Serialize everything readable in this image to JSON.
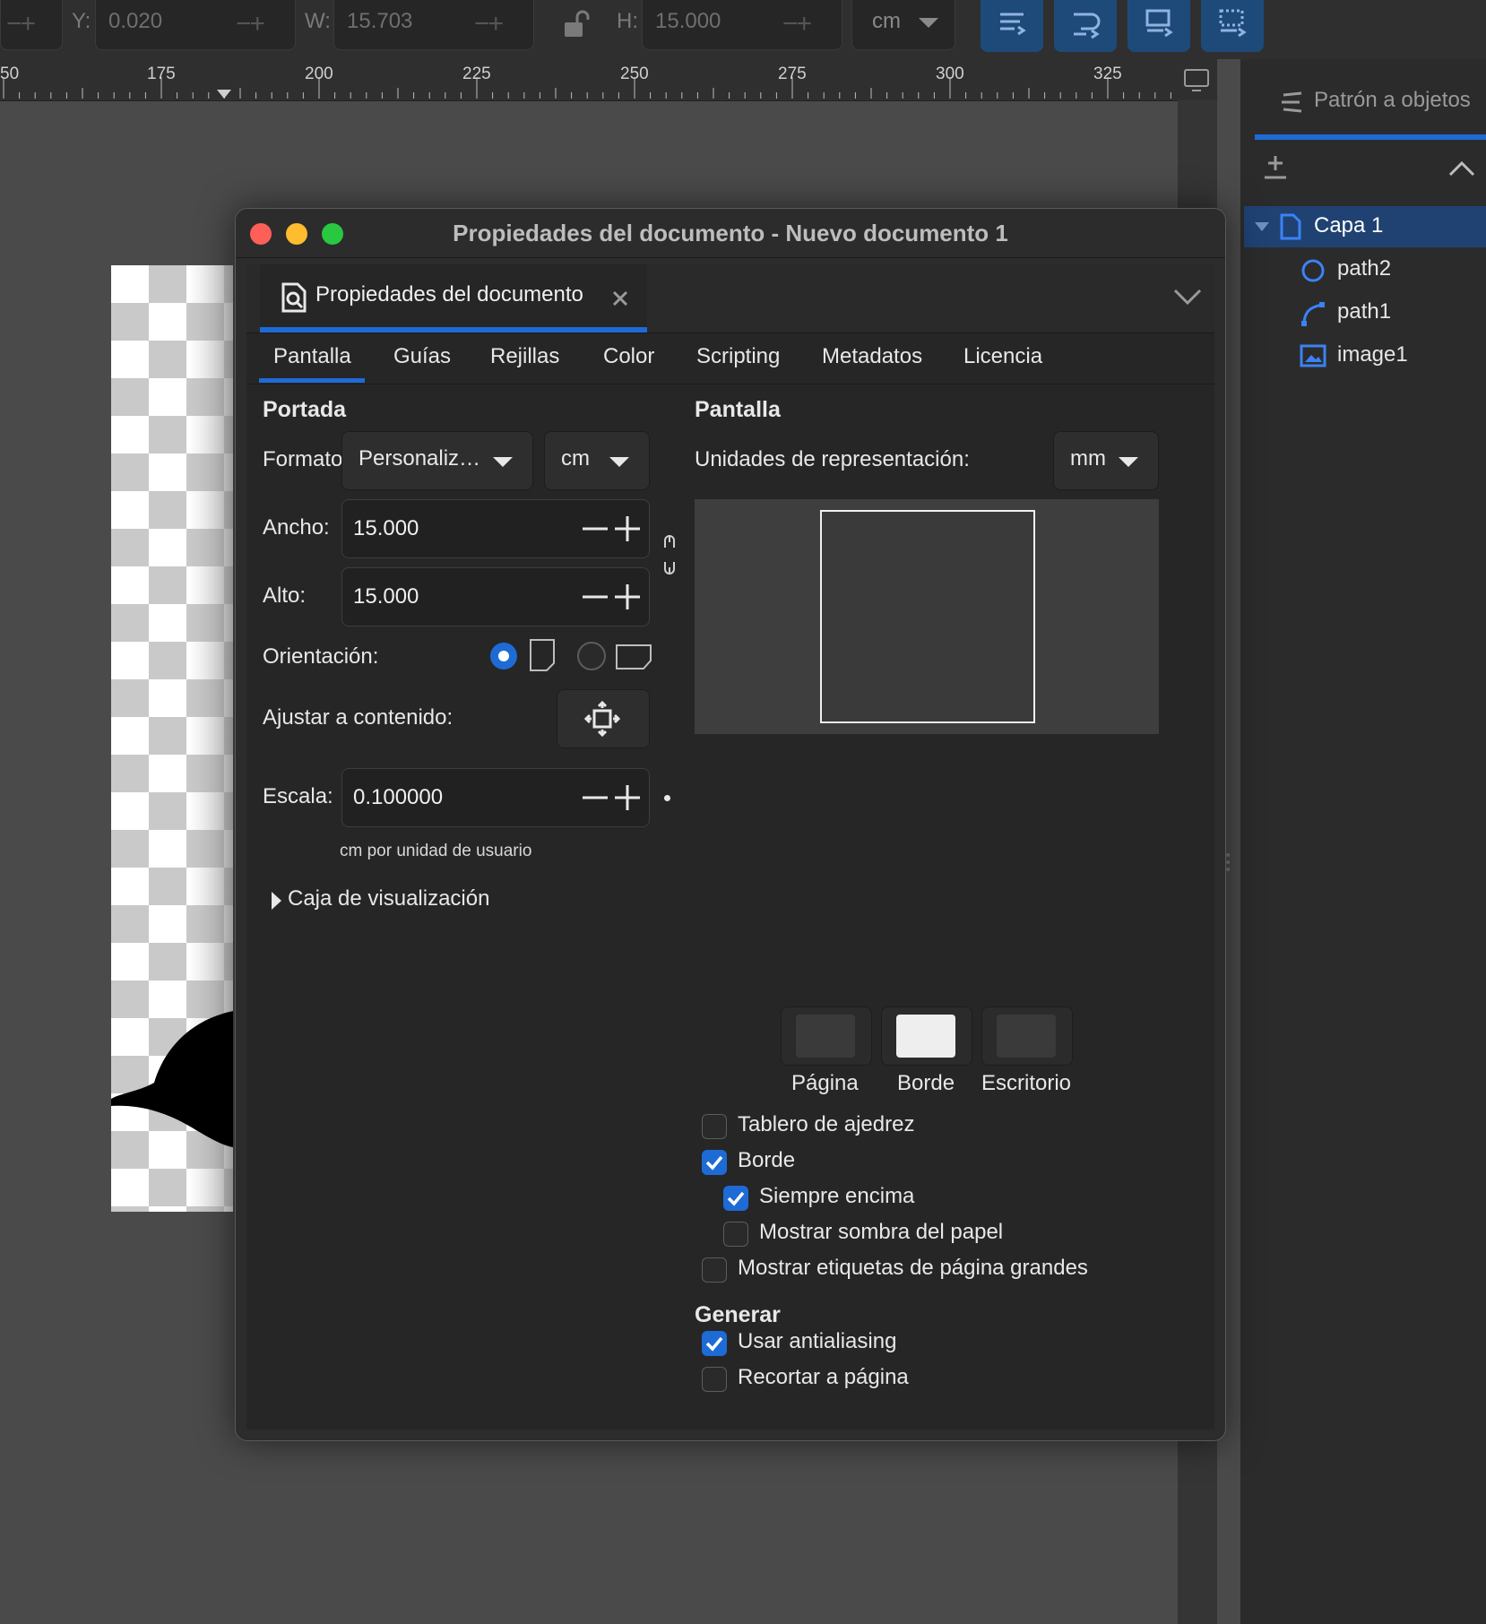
{
  "toolbar": {
    "y_label": "Y:",
    "y_value": "0.020",
    "w_label": "W:",
    "w_value": "15.703",
    "h_label": "H:",
    "h_value": "15.000",
    "unit": "cm",
    "icons": [
      "lock-open-icon",
      "align-icon-1",
      "align-icon-2",
      "align-icon-3",
      "align-icon-4"
    ]
  },
  "ruler": {
    "labels": [
      "50",
      "175",
      "200",
      "225",
      "250",
      "275",
      "300",
      "325"
    ]
  },
  "right_panel": {
    "tab_label": "Patrón a objetos",
    "layer": "Capa 1",
    "objects": [
      {
        "label": "path2",
        "icon": "circle-icon"
      },
      {
        "label": "path1",
        "icon": "bezier-path-icon"
      },
      {
        "label": "image1",
        "icon": "image-icon"
      }
    ]
  },
  "dialog": {
    "title": "Propiedades del documento - Nuevo documento 1",
    "doc_tab_label": "Propiedades del documento",
    "tabs": [
      "Pantalla",
      "Guías",
      "Rejillas",
      "Color",
      "Scripting",
      "Metadatos",
      "Licencia"
    ],
    "active_tab": "Pantalla",
    "portada": {
      "title": "Portada",
      "formato_label": "Formato:",
      "formato_value": "Personaliz…",
      "formato_unit": "cm",
      "ancho_label": "Ancho:",
      "ancho_value": "15.000",
      "alto_label": "Alto:",
      "alto_value": "15.000",
      "orientacion_label": "Orientación:",
      "orientation_selected": "portrait",
      "ajustar_label": "Ajustar a contenido:",
      "escala_label": "Escala:",
      "escala_value": "0.100000",
      "escala_unit_note": "cm por unidad de usuario",
      "viewbox_label": "Caja de visualización"
    },
    "pantalla": {
      "title": "Pantalla",
      "units_label": "Unidades de representación:",
      "units_value": "mm",
      "swatches": [
        {
          "label": "Página",
          "color": "#3a3a3a"
        },
        {
          "label": "Borde",
          "color": "#eeeeee"
        },
        {
          "label": "Escritorio",
          "color": "#3a3a3a"
        }
      ],
      "checks": [
        {
          "label": "Tablero de ajedrez",
          "checked": false
        },
        {
          "label": "Borde",
          "checked": true
        },
        {
          "label": "Siempre encima",
          "checked": true
        },
        {
          "label": "Mostrar sombra del papel",
          "checked": false
        },
        {
          "label": "Mostrar etiquetas de página grandes",
          "checked": false
        }
      ]
    },
    "generar": {
      "title": "Generar",
      "checks": [
        {
          "label": "Usar antialiasing",
          "checked": true
        },
        {
          "label": "Recortar a página",
          "checked": false
        }
      ]
    }
  },
  "colors": {
    "accent": "#1e6bd6",
    "close_light": "#fe5f57",
    "min_light": "#febc2e",
    "max_light": "#28c840"
  }
}
